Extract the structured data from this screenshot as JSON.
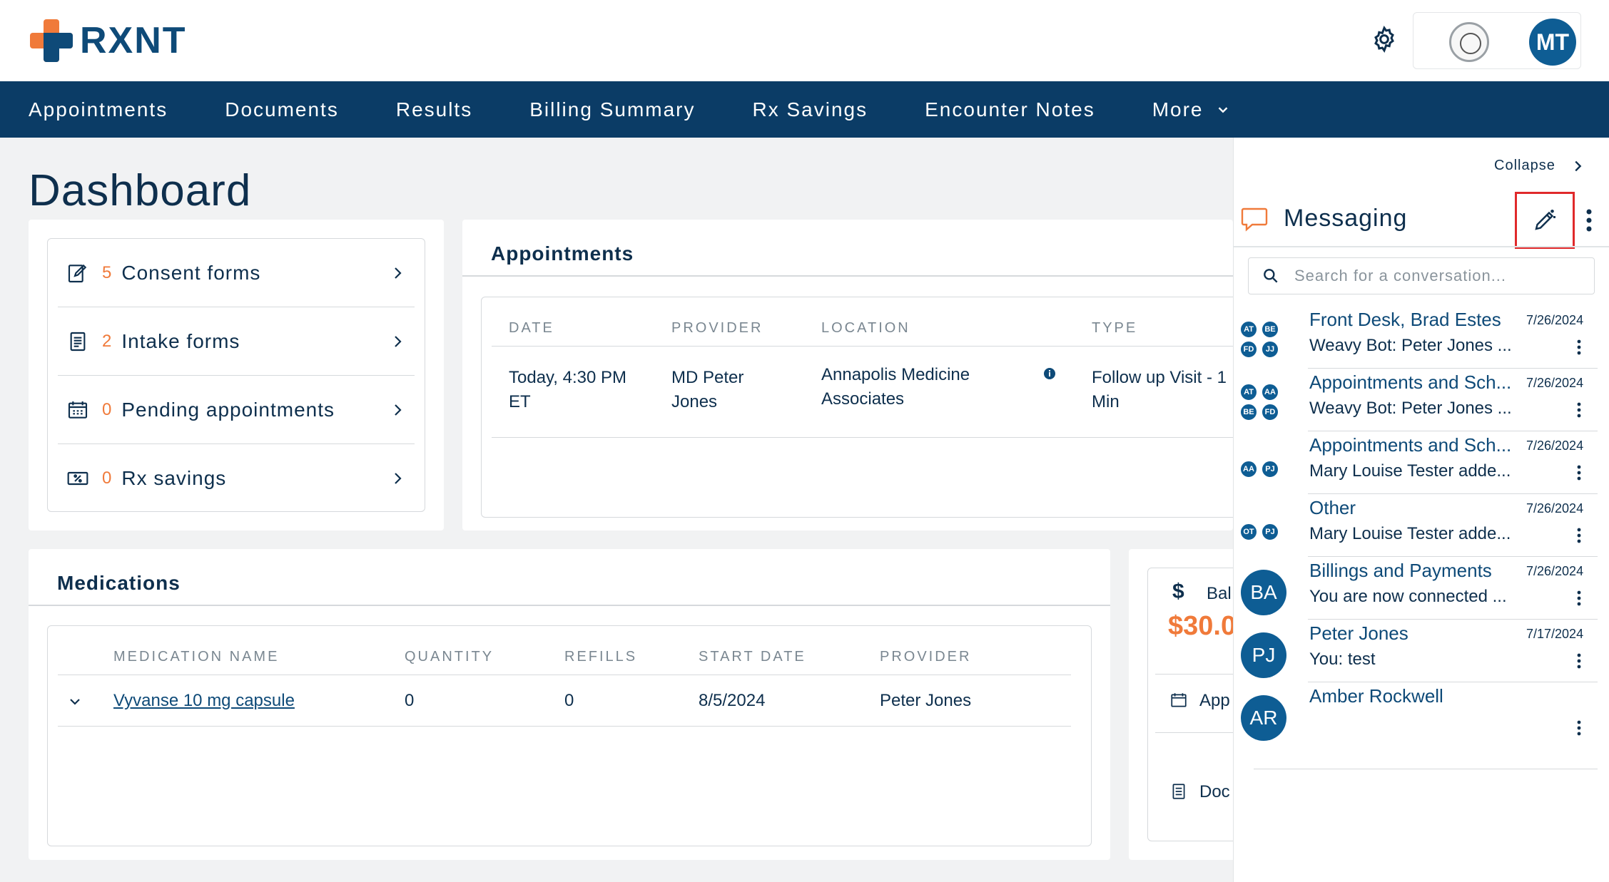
{
  "brand": {
    "name": "RXNT"
  },
  "header": {
    "avatar_initials": "MT"
  },
  "nav": {
    "items": [
      "Appointments",
      "Documents",
      "Results",
      "Billing Summary",
      "Rx Savings",
      "Encounter Notes",
      "More"
    ]
  },
  "page": {
    "title": "Dashboard"
  },
  "quick_links": [
    {
      "count": "5",
      "label": "Consent forms"
    },
    {
      "count": "2",
      "label": "Intake forms"
    },
    {
      "count": "0",
      "label": "Pending appointments"
    },
    {
      "count": "0",
      "label": "Rx savings"
    }
  ],
  "appointments": {
    "title": "Appointments",
    "headers": [
      "DATE",
      "PROVIDER",
      "LOCATION",
      "TYPE"
    ],
    "row": {
      "date_line1": "Today, 4:30 PM",
      "date_line2": "ET",
      "provider_line1": "MD Peter",
      "provider_line2": "Jones",
      "location_line1": "Annapolis Medicine",
      "location_line2": "Associates",
      "type_line1": "Follow up Visit - 1",
      "type_line2": "Min"
    }
  },
  "medications": {
    "title": "Medications",
    "headers": [
      "MEDICATION NAME",
      "QUANTITY",
      "REFILLS",
      "START DATE",
      "PROVIDER"
    ],
    "rows": [
      {
        "name": "Vyvanse 10 mg capsule",
        "quantity": "0",
        "refills": "0",
        "start_date": "8/5/2024",
        "provider": "Peter Jones"
      }
    ]
  },
  "balance": {
    "label": "Bal",
    "amount": "$30.0",
    "link1": "App",
    "link2": "Doc"
  },
  "messaging": {
    "collapse_label": "Collapse",
    "title": "Messaging",
    "search_placeholder": "Search for a conversation...",
    "conversations": [
      {
        "name": "Front Desk, Brad Estes",
        "date": "7/26/2024",
        "preview": "Weavy Bot: Peter Jones ...",
        "avatars": [
          "AT",
          "BE",
          "FD",
          "JJ"
        ]
      },
      {
        "name": "Appointments and Sch...",
        "date": "7/26/2024",
        "preview": "Weavy Bot: Peter Jones ...",
        "avatars": [
          "AT",
          "AA",
          "BE",
          "FD"
        ]
      },
      {
        "name": "Appointments and Sch...",
        "date": "7/26/2024",
        "preview": "Mary Louise Tester adde...",
        "avatars": [
          "AA",
          "PJ"
        ]
      },
      {
        "name": "Other",
        "date": "7/26/2024",
        "preview": "Mary Louise Tester adde...",
        "avatars": [
          "OT",
          "PJ"
        ]
      },
      {
        "name": "Billings and Payments",
        "date": "7/26/2024",
        "preview": "You are now connected ...",
        "avatar": "BA"
      },
      {
        "name": "Peter Jones",
        "date": "7/17/2024",
        "preview": "You: test",
        "avatar": "PJ"
      },
      {
        "name": "Amber Rockwell",
        "date": "",
        "preview": "",
        "avatar": "AR"
      }
    ]
  },
  "colors": {
    "primary": "#0b3c66",
    "accent": "#f07a3a",
    "highlight": "#e0292b"
  }
}
